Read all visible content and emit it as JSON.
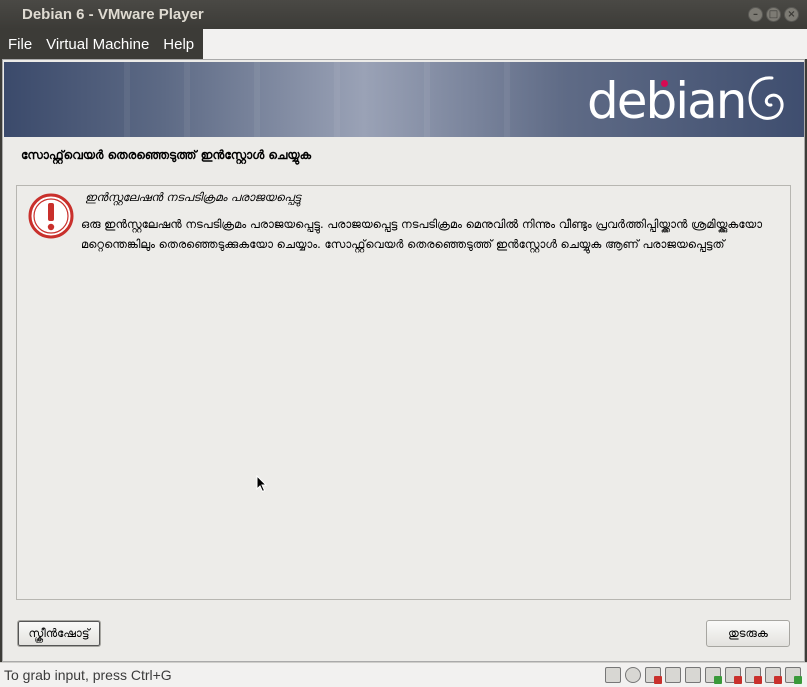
{
  "window": {
    "title": "Debian 6 - VMware Player",
    "minimize_glyph": "–",
    "maximize_glyph": "□",
    "close_glyph": "×"
  },
  "menu": {
    "items": [
      {
        "label": "File"
      },
      {
        "label": "Virtual Machine"
      },
      {
        "label": "Help"
      }
    ]
  },
  "installer": {
    "brand": "debian",
    "brand_color": "#d70a53",
    "heading": "സോഫ്റ്റ്‌വെയര്‍ തെരഞ്ഞെടുത്ത് ഇന്‍സ്റ്റോള്‍ ചെയ്യുക",
    "alert": {
      "icon": "error-icon",
      "title": "ഇന്‍സ്റ്റലേഷന്‍ നടപടിക്രമം പരാജയപ്പെട്ടു",
      "body": "ഒരു ഇന്‍സ്റ്റലേഷന്‍ നടപടിക്രമം പരാജയപ്പെട്ടു. പരാജയപ്പെട്ട നടപടിക്രമം മെനുവില്‍ നിന്നും വീണ്ടും പ്രവര്‍ത്തിപ്പിയ്ക്കാന്‍ ശ്രമിയ്ക്കുകയോ മറ്റെന്തെങ്കിലും തെരഞ്ഞെടുക്കുകയോ ചെയ്യാം. സോഫ്റ്റ്‌വെയര്‍ തെരഞ്ഞെടുത്ത് ഇന്‍സ്റ്റോള്‍ ചെയ്യുക ആണ് പരാജയപ്പെട്ടത്"
    },
    "buttons": {
      "screenshot": "സ്ക്രീന്‍ഷോട്ട്",
      "continue": "തുടരുക"
    }
  },
  "statusbar": {
    "hint": "To grab input, press Ctrl+G",
    "devices": [
      "hard-disk-icon",
      "cd-icon",
      "floppy-icon",
      "network-icon",
      "printer-icon",
      "usb-icon",
      "usb-icon",
      "usb-icon",
      "sound-icon",
      "message-icon"
    ]
  },
  "colors": {
    "titlebar": "#3c3b37",
    "guest_background": "#ecebe8",
    "alert_red": "#c9302c"
  }
}
